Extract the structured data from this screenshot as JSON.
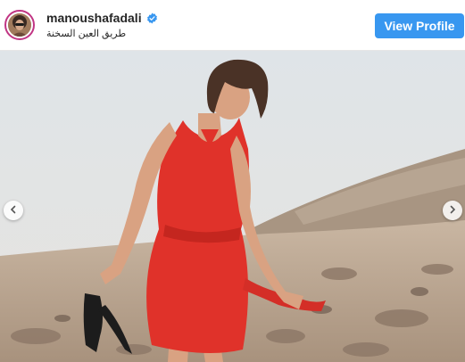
{
  "post": {
    "username": "manoushafadali",
    "location": "طريق العين السخنة",
    "view_profile_label": "View Profile"
  },
  "icons": {
    "verified": "verified-badge-icon",
    "prev": "chevron-left-icon",
    "next": "chevron-right-icon"
  },
  "colors": {
    "button": "#3897f0",
    "dress": "#e0322a",
    "sky": "#d9dfe4",
    "sand": "#c8b39d"
  }
}
